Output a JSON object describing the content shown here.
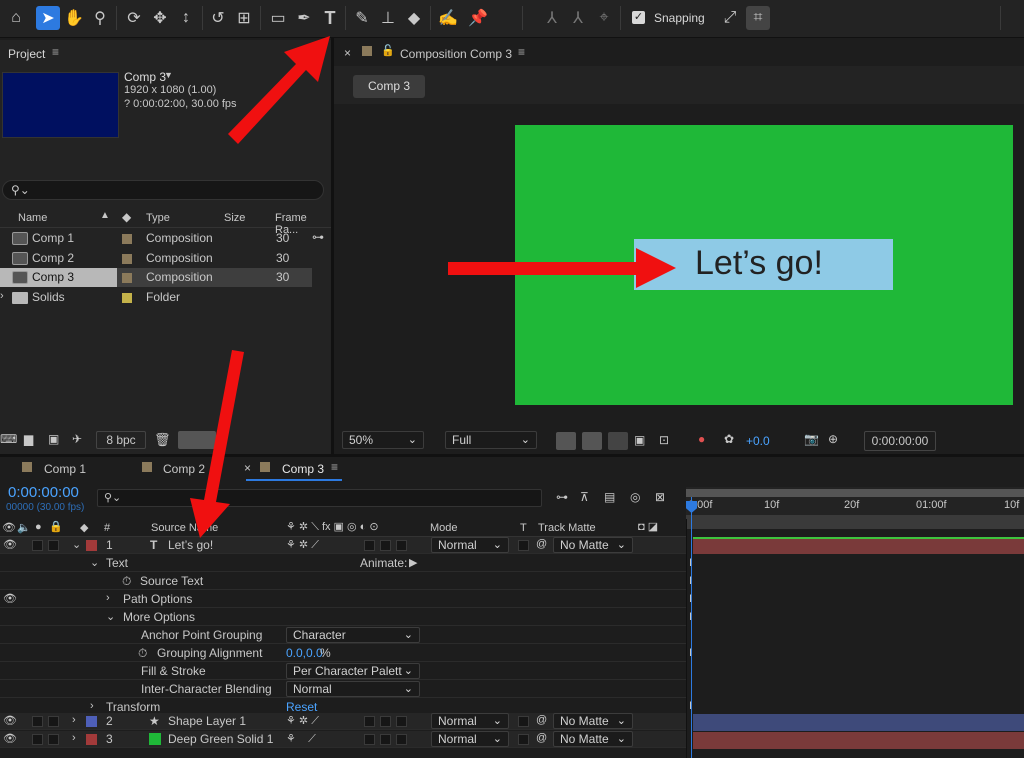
{
  "toolbar": {
    "snapping_label": "Snapping",
    "tools": [
      "home-icon",
      "selection-arrow-icon",
      "hand-icon",
      "zoom-icon",
      "orbit-icon",
      "pan-icon",
      "dolly-icon",
      "rotate-icon",
      "pan-behind-icon",
      "rectangle-icon",
      "pen-icon",
      "type-tool-icon",
      "brush-icon",
      "clone-stamp-icon",
      "eraser-icon",
      "roto-brush-icon",
      "puppet-pin-icon"
    ]
  },
  "project": {
    "tab_label": "Project",
    "comp_title": "Comp 3",
    "comp_size": "1920 x 1080 (1.00)",
    "comp_duration": "? 0:00:02:00, 30.00 fps",
    "thumb_color": "#001060",
    "columns": {
      "name": "Name",
      "type": "Type",
      "size": "Size",
      "rate": "Frame Ra..."
    },
    "items": [
      {
        "name": "Comp 1",
        "type": "Composition",
        "rate": "30",
        "swatch": "#8b7a5b"
      },
      {
        "name": "Comp 2",
        "type": "Composition",
        "rate": "30",
        "swatch": "#8b7a5b"
      },
      {
        "name": "Comp 3",
        "type": "Composition",
        "rate": "30",
        "swatch": "#8b7a5b"
      },
      {
        "name": "Solids",
        "type": "Folder",
        "rate": "",
        "swatch": "#c4b24a"
      }
    ],
    "bpc": "8 bpc"
  },
  "viewer": {
    "tab_label": "Composition Comp 3",
    "comp_button": "Comp 3",
    "canvas_color": "#1fb838",
    "text_box_color": "#8ecae6",
    "canvas_text": "Let’s go!",
    "zoom": "50%",
    "resolution": "Full",
    "exposure": "+0.0",
    "timecode": "0:00:00:00"
  },
  "timeline": {
    "tabs": [
      "Comp 1",
      "Comp 2",
      "Comp 3"
    ],
    "timecode": "0:00:00:00",
    "frame_info": "00000 (30.00 fps)",
    "ruler": [
      "0:00f",
      "10f",
      "20f",
      "01:00f",
      "10f"
    ],
    "headers": {
      "num": "#",
      "source": "Source Name",
      "mode": "Mode",
      "t": "T",
      "matte": "Track Matte"
    },
    "layers": [
      {
        "num": "1",
        "name": "Let’s go!",
        "mode": "Normal",
        "matte": "No Matte",
        "label": "#a23a3a"
      },
      {
        "num": "2",
        "name": "Shape Layer 1",
        "mode": "Normal",
        "matte": "No Matte",
        "label": "#4e5fb8"
      },
      {
        "num": "3",
        "name": "Deep Green Solid 1",
        "mode": "Normal",
        "matte": "No Matte",
        "label": "#a23a3a"
      }
    ],
    "props": {
      "text": "Text",
      "animate": "Animate:",
      "source_text": "Source Text",
      "path_options": "Path Options",
      "more_options": "More Options",
      "anchor_grouping": "Anchor Point Grouping",
      "anchor_grouping_val": "Character",
      "grouping_alignment": "Grouping Alignment",
      "grouping_alignment_val": "0.0,0.0",
      "grouping_alignment_unit": "%",
      "fill_stroke": "Fill & Stroke",
      "fill_stroke_val": "Per Character Palett",
      "inter_blend": "Inter-Character Blending",
      "inter_blend_val": "Normal",
      "transform": "Transform",
      "reset": "Reset"
    }
  },
  "colors": {
    "accent": "#2d7ae0",
    "arrow": "#f01010",
    "timecode": "#4aa3ff"
  }
}
